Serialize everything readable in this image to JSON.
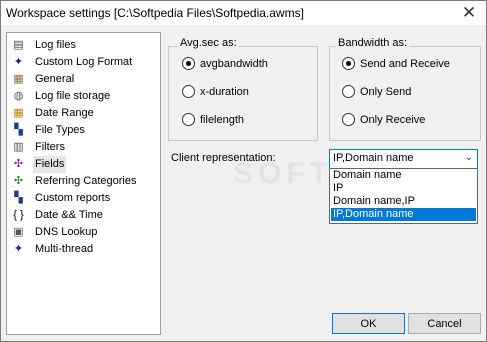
{
  "window": {
    "title": "Workspace settings [C:\\Softpedia Files\\Softpedia.awms]",
    "close_glyph": "✕"
  },
  "tree": {
    "items": [
      {
        "label": "Log files",
        "icon": "log-files-icon",
        "glyph": "▤",
        "color": "#444444"
      },
      {
        "label": "Custom Log Format",
        "icon": "pin-icon",
        "glyph": "✦",
        "color": "#1a237e"
      },
      {
        "label": "General",
        "icon": "general-settings-icon",
        "glyph": "▦",
        "color": "#8d6e3f"
      },
      {
        "label": "Log file storage",
        "icon": "database-icon",
        "glyph": "◍",
        "color": "#555555"
      },
      {
        "label": "Date Range",
        "icon": "calendar-icon",
        "glyph": "▦",
        "color": "#b8860b"
      },
      {
        "label": "File Types",
        "icon": "file-types-icon",
        "glyph": "▚",
        "color": "#1e3a8a"
      },
      {
        "label": "Filters",
        "icon": "filter-icon",
        "glyph": "▥",
        "color": "#555555"
      },
      {
        "label": "Fields",
        "icon": "fields-icon",
        "glyph": "✣",
        "color": "#7b1fa2"
      },
      {
        "label": "Referring Categories",
        "icon": "categories-icon",
        "glyph": "✣",
        "color": "#2e7d32"
      },
      {
        "label": "Custom reports",
        "icon": "custom-reports-icon",
        "glyph": "▚",
        "color": "#1e3a8a"
      },
      {
        "label": "Date && Time",
        "icon": "braces-icon",
        "glyph": "{ }",
        "color": "#000000"
      },
      {
        "label": "DNS Lookup",
        "icon": "dns-lookup-icon",
        "glyph": "▣",
        "color": "#555555"
      },
      {
        "label": "Multi-thread",
        "icon": "multithread-icon",
        "glyph": "✦",
        "color": "#1a237e"
      }
    ],
    "selected_index": 7
  },
  "avg_group": {
    "legend": "Avg.sec as:",
    "options": [
      "avgbandwidth",
      "x-duration",
      "filelength"
    ],
    "selected": 0
  },
  "bandwidth_group": {
    "legend": "Bandwidth as:",
    "options": [
      "Send and Receive",
      "Only Send",
      "Only Receive"
    ],
    "selected": 0
  },
  "client": {
    "label": "Client representation:",
    "value": "IP,Domain name",
    "arrow": "⌄",
    "options": [
      "Domain name",
      "IP",
      "Domain name,IP",
      "IP,Domain name"
    ],
    "highlighted": 3
  },
  "buttons": {
    "ok": "OK",
    "cancel": "Cancel"
  },
  "watermark": "SOFTPEDIA"
}
